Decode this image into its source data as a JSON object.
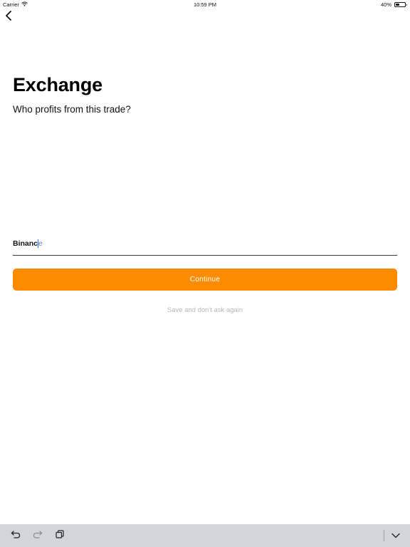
{
  "status_bar": {
    "carrier": "Carrier",
    "time": "10:59 PM",
    "battery": "40%",
    "battery_level": 0.4
  },
  "nav": {
    "back_icon": "chevron-left-icon"
  },
  "header": {
    "title": "Exchange",
    "subtitle": "Who profits from this trade?"
  },
  "form": {
    "input_value_typed": "Binanc",
    "input_value_suggested": "e"
  },
  "actions": {
    "continue_label": "Continue",
    "save_label": "Save and don't ask again"
  },
  "colors": {
    "accent": "#ff8c00",
    "keyboard_bar": "#d3d5db",
    "cursor": "#2f6bff"
  },
  "keyboard_bar": {
    "icons": [
      "undo-icon",
      "redo-icon",
      "paste-icon",
      "dismiss-keyboard-icon"
    ]
  }
}
